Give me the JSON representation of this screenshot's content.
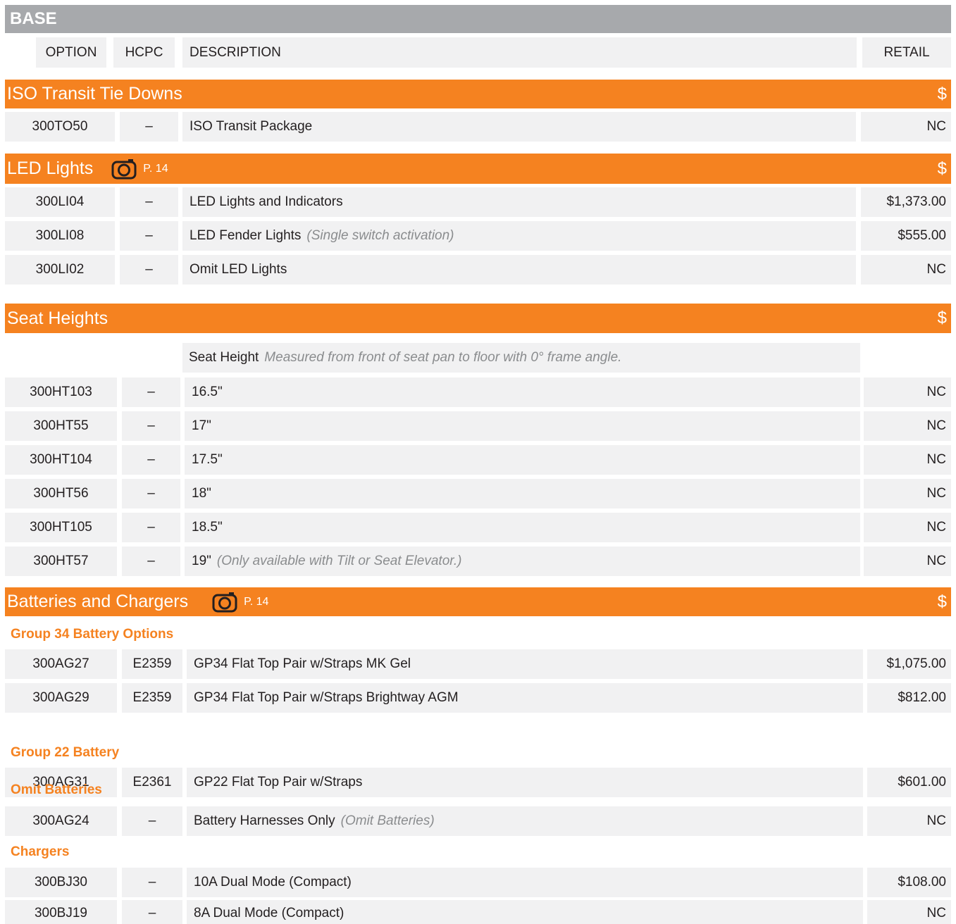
{
  "base": {
    "title": "BASE"
  },
  "columns": {
    "option": "OPTION",
    "hcpc": "HCPC",
    "description": "DESCRIPTION",
    "retail": "RETAIL"
  },
  "colors": {
    "accent": "#f58220",
    "header_gray": "#a7a9ac",
    "cell_bg": "#f1f1f2"
  },
  "sections": {
    "iso": {
      "title": "ISO Transit Tie Downs",
      "dollar": "$",
      "rows": [
        {
          "option": "300TO50",
          "hcpc": "–",
          "desc": "ISO Transit Package",
          "note": "",
          "retail": "NC"
        }
      ]
    },
    "led": {
      "title": "LED Lights",
      "dollar": "$",
      "page_ref": "P. 14",
      "icon": "camera-icon",
      "rows": [
        {
          "option": "300LI04",
          "hcpc": "–",
          "desc": "LED Lights and Indicators",
          "note": "",
          "retail": "$1,373.00"
        },
        {
          "option": "300LI08",
          "hcpc": "–",
          "desc": "LED Fender Lights",
          "note": "(Single switch activation)",
          "retail": "$555.00"
        },
        {
          "option": "300LI02",
          "hcpc": "–",
          "desc": "Omit LED Lights",
          "note": "",
          "retail": "NC"
        }
      ]
    },
    "seat": {
      "title": "Seat Heights",
      "dollar": "$",
      "subtitle": "Seat Height",
      "subtitle_note": "Measured from front of seat pan to floor with 0° frame angle.",
      "rows": [
        {
          "option": "300HT103",
          "hcpc": "–",
          "desc": "16.5\"",
          "note": "",
          "retail": "NC"
        },
        {
          "option": "300HT55",
          "hcpc": "–",
          "desc": "17\"",
          "note": "",
          "retail": "NC"
        },
        {
          "option": "300HT104",
          "hcpc": "–",
          "desc": "17.5\"",
          "note": "",
          "retail": "NC"
        },
        {
          "option": "300HT56",
          "hcpc": "–",
          "desc": "18\"",
          "note": "",
          "retail": "NC"
        },
        {
          "option": "300HT105",
          "hcpc": "–",
          "desc": "18.5\"",
          "note": "",
          "retail": "NC"
        },
        {
          "option": "300HT57",
          "hcpc": "–",
          "desc": "19\"",
          "note": "(Only available with Tilt or Seat Elevator.)",
          "retail": "NC"
        }
      ]
    },
    "batt": {
      "title": "Batteries and Chargers",
      "dollar": "$",
      "page_ref": "P. 14",
      "icon": "camera-icon",
      "groups": [
        {
          "heading": "Group 34 Battery Options",
          "rows": [
            {
              "option": "300AG27",
              "hcpc": "E2359",
              "desc": "GP34 Flat Top Pair w/Straps MK Gel",
              "note": "",
              "retail": "$1,075.00"
            },
            {
              "option": "300AG29",
              "hcpc": "E2359",
              "desc": "GP34 Flat Top Pair w/Straps Brightway AGM",
              "note": "",
              "retail": "$812.00"
            }
          ]
        },
        {
          "heading": "Group 22 Battery",
          "rows": [
            {
              "option": "300AG31",
              "hcpc": "E2361",
              "desc": "GP22 Flat Top Pair w/Straps",
              "note": "",
              "retail": "$601.00"
            }
          ]
        },
        {
          "heading": "Omit Batteries",
          "rows": [
            {
              "option": "300AG24",
              "hcpc": "–",
              "desc": "Battery Harnesses Only",
              "note": "(Omit Batteries)",
              "retail": "NC"
            }
          ]
        },
        {
          "heading": "Chargers",
          "rows": [
            {
              "option": "300BJ30",
              "hcpc": "–",
              "desc": "10A Dual Mode (Compact)",
              "note": "",
              "retail": "$108.00"
            },
            {
              "option": "300BJ19",
              "hcpc": "–",
              "desc": "8A Dual Mode (Compact)",
              "note": "",
              "retail": "NC"
            }
          ]
        }
      ]
    }
  }
}
